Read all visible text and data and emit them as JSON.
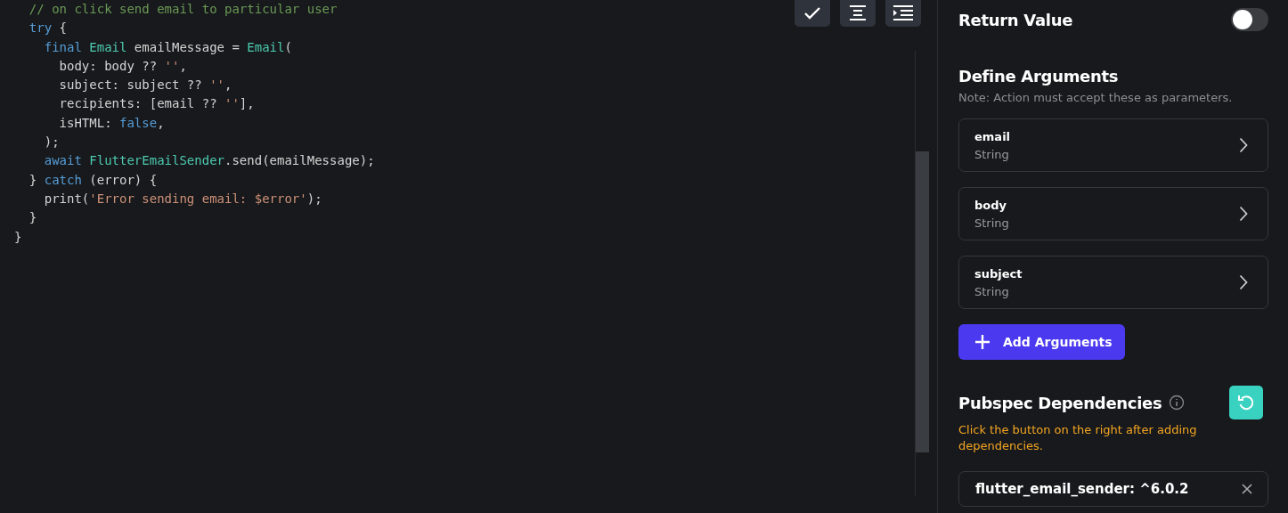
{
  "code": {
    "body": [
      {
        "tokens": [
          {
            "text": "// on click send email to particular user",
            "kind": "comment"
          }
        ]
      },
      {
        "tokens": [
          {
            "text": "try",
            "kind": "keyword"
          },
          {
            "text": " {",
            "kind": "plain"
          }
        ],
        "children": [
          {
            "tokens": [
              {
                "text": "final",
                "kind": "keyword"
              },
              {
                "text": " Email",
                "kind": "type"
              },
              {
                "text": " emailMessage = ",
                "kind": "plain"
              },
              {
                "text": "Email",
                "kind": "type"
              },
              {
                "text": "(",
                "kind": "plain"
              }
            ],
            "children": [
              {
                "tokens": [
                  {
                    "text": "body: body ?? ",
                    "kind": "plain"
                  },
                  {
                    "text": "''",
                    "kind": "string"
                  },
                  {
                    "text": ",",
                    "kind": "plain"
                  }
                ]
              },
              {
                "tokens": [
                  {
                    "text": "subject: subject ?? ",
                    "kind": "plain"
                  },
                  {
                    "text": "''",
                    "kind": "string"
                  },
                  {
                    "text": ",",
                    "kind": "plain"
                  }
                ]
              },
              {
                "tokens": [
                  {
                    "text": "recipients: [email ?? ",
                    "kind": "plain"
                  },
                  {
                    "text": "''",
                    "kind": "string"
                  },
                  {
                    "text": "],",
                    "kind": "plain"
                  }
                ]
              },
              {
                "tokens": [
                  {
                    "text": "isHTML: ",
                    "kind": "plain"
                  },
                  {
                    "text": "false",
                    "kind": "keyword"
                  },
                  {
                    "text": ",",
                    "kind": "plain"
                  }
                ]
              }
            ]
          },
          {
            "tokens": [
              {
                "text": ");",
                "kind": "plain"
              }
            ]
          },
          {
            "tokens": [
              {
                "text": "await",
                "kind": "keyword"
              },
              {
                "text": " FlutterEmailSender",
                "kind": "type"
              },
              {
                "text": ".send(emailMessage);",
                "kind": "plain"
              }
            ]
          }
        ]
      },
      {
        "tokens": [
          {
            "text": "} ",
            "kind": "plain"
          },
          {
            "text": "catch",
            "kind": "keyword"
          },
          {
            "text": " (error) {",
            "kind": "plain"
          }
        ],
        "children": [
          {
            "tokens": [
              {
                "text": "print(",
                "kind": "plain"
              },
              {
                "text": "'Error sending email: $error'",
                "kind": "string"
              },
              {
                "text": ");",
                "kind": "plain"
              }
            ]
          }
        ]
      },
      {
        "tokens": [
          {
            "text": "}",
            "kind": "plain"
          }
        ]
      }
    ],
    "closing": [
      {
        "tokens": [
          {
            "text": "}",
            "kind": "plain"
          }
        ]
      }
    ]
  },
  "toolbar": [
    {
      "kind": "check"
    },
    {
      "kind": "align-center"
    },
    {
      "kind": "indent"
    }
  ],
  "return_value": {
    "label": "Return Value",
    "on": false
  },
  "arguments": {
    "title": "Define Arguments",
    "note": "Note: Action must accept these as parameters.",
    "items": [
      {
        "name": "email",
        "type": "String"
      },
      {
        "name": "body",
        "type": "String"
      },
      {
        "name": "subject",
        "type": "String"
      }
    ],
    "add_button": "Add Arguments"
  },
  "dependencies": {
    "title": "Pubspec Dependencies",
    "hint": "Click the button on the right after adding dependencies.",
    "items": [
      {
        "text": "flutter_email_sender: ^6.0.2"
      }
    ]
  }
}
